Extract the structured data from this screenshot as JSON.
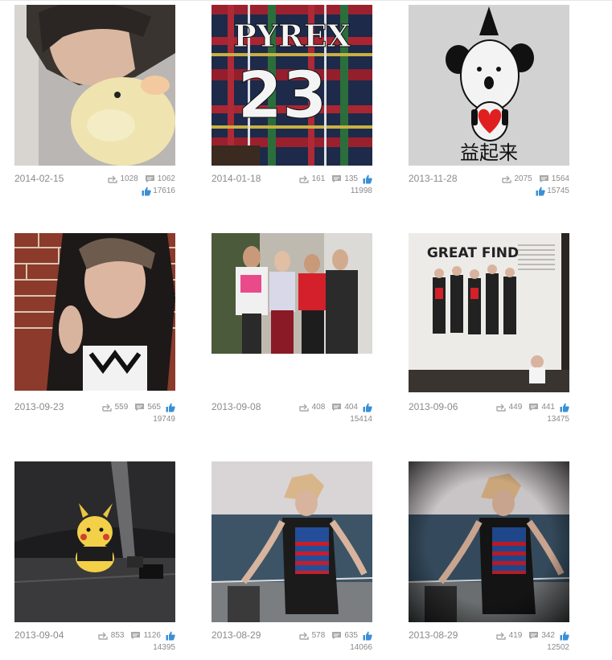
{
  "posts": [
    {
      "date": "2014-02-15",
      "reposts": "1028",
      "comments": "1062",
      "likes": "17616",
      "img_h": 200,
      "likes_inline": false
    },
    {
      "date": "2014-01-18",
      "reposts": "161",
      "comments": "135",
      "likes": "11998",
      "img_h": 200,
      "likes_inline": true
    },
    {
      "date": "2013-11-28",
      "reposts": "2075",
      "comments": "1564",
      "likes": "15745",
      "img_h": 200,
      "likes_inline": false
    },
    {
      "date": "2013-09-23",
      "reposts": "559",
      "comments": "565",
      "likes": "19749",
      "img_h": 196,
      "likes_inline": true
    },
    {
      "date": "2013-09-08",
      "reposts": "408",
      "comments": "404",
      "likes": "15414",
      "img_h": 150,
      "likes_inline": true
    },
    {
      "date": "2013-09-06",
      "reposts": "449",
      "comments": "441",
      "likes": "13475",
      "img_h": 198,
      "likes_inline": true
    },
    {
      "date": "2013-09-04",
      "reposts": "853",
      "comments": "1126",
      "likes": "14395",
      "img_h": 200,
      "likes_inline": true
    },
    {
      "date": "2013-08-29",
      "reposts": "578",
      "comments": "635",
      "likes": "14066",
      "img_h": 200,
      "likes_inline": true
    },
    {
      "date": "2013-08-29",
      "reposts": "419",
      "comments": "342",
      "likes": "12502",
      "img_h": 200,
      "likes_inline": true
    }
  ],
  "photo_text": {
    "jersey_name": "PYREX",
    "jersey_number": "23",
    "drawing_caption": "益起来",
    "magazine_title": "GREAT FIND"
  },
  "colors": {
    "text": "#8a8a8a",
    "like_blue": "#3a8fd6",
    "icon_gray": "#a8a8a8"
  }
}
